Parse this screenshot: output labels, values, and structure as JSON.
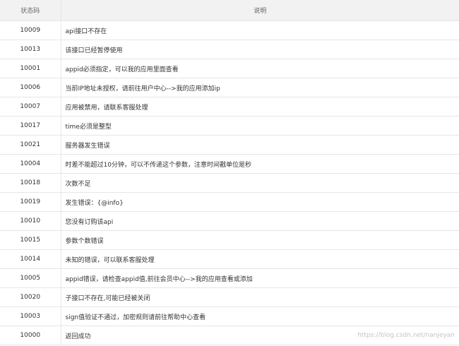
{
  "table": {
    "headers": [
      "状态码",
      "说明"
    ],
    "rows": [
      {
        "code": "10009",
        "desc": "api接口不存在"
      },
      {
        "code": "10013",
        "desc": "该接口已经暂停使用"
      },
      {
        "code": "10001",
        "desc": "appid必须指定，可以我的应用里面查看"
      },
      {
        "code": "10006",
        "desc": "当前IP地址未授权，请前往用户中心-->我的应用添加ip"
      },
      {
        "code": "10007",
        "desc": "应用被禁用，请联系客服处理"
      },
      {
        "code": "10017",
        "desc": "time必须是整型"
      },
      {
        "code": "10021",
        "desc": "服务器发生错误"
      },
      {
        "code": "10004",
        "desc": "时差不能超过10分钟，可以不传递这个参数，注意时间戳单位是秒"
      },
      {
        "code": "10018",
        "desc": "次数不足"
      },
      {
        "code": "10019",
        "desc": "发生错误：{@info}"
      },
      {
        "code": "10010",
        "desc": "您没有订购该api"
      },
      {
        "code": "10015",
        "desc": "参数个数错误"
      },
      {
        "code": "10014",
        "desc": "未知的错误，可以联系客服处理"
      },
      {
        "code": "10005",
        "desc": "appid错误，请检查appid值,前往会员中心-->我的应用查看或添加"
      },
      {
        "code": "10020",
        "desc": "子接口不存在,可能已经被关闭"
      },
      {
        "code": "10003",
        "desc": "sign值验证不通过，加密规则请前往帮助中心查看"
      },
      {
        "code": "10000",
        "desc": "返回成功"
      }
    ]
  },
  "watermark": "https://blog.csdn.net/nanjeyan"
}
